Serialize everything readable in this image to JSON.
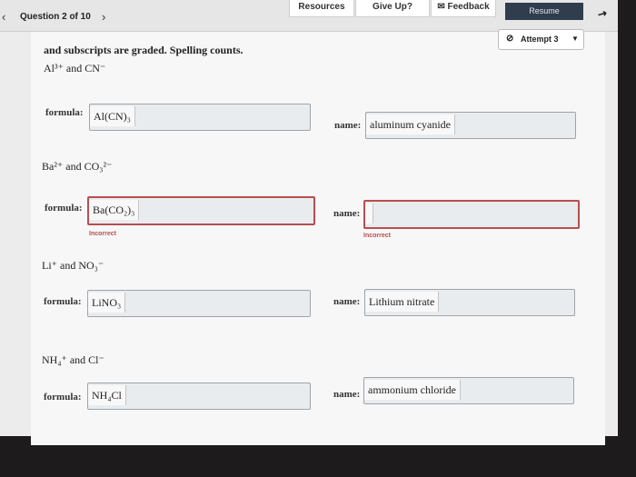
{
  "topbar": {
    "resources_label": "Resources",
    "give_up_label": "Give Up?",
    "feedback_label": "Feedback",
    "resume_label": "Resume"
  },
  "question": {
    "title": "Question 2 of 10",
    "prev_icon": "chevron-left-icon",
    "next_icon": "chevron-right-icon"
  },
  "attempt": {
    "label": "Attempt 3"
  },
  "instructions": "and subscripts are graded. Spelling counts.",
  "items": [
    {
      "ions": "Al³⁺ and CN⁻",
      "formula": "Al(CN)₃",
      "name": "aluminum cyanide",
      "formula_status": "",
      "name_status": ""
    },
    {
      "ions": "Ba²⁺ and CO₃²⁻",
      "formula": "Ba(CO₂)₃",
      "name": "",
      "formula_status": "Incorrect",
      "name_status": "Incorrect"
    },
    {
      "ions": "Li⁺ and NO₃⁻",
      "formula": "LiNO₃",
      "name": "Lithium nitrate",
      "formula_status": "",
      "name_status": ""
    },
    {
      "ions": "NH₄⁺ and Cl⁻",
      "formula": "NH₄Cl",
      "name": "ammonium chloride",
      "formula_status": "",
      "name_status": ""
    }
  ],
  "labels": {
    "formula": "formula:",
    "name": "name:"
  }
}
